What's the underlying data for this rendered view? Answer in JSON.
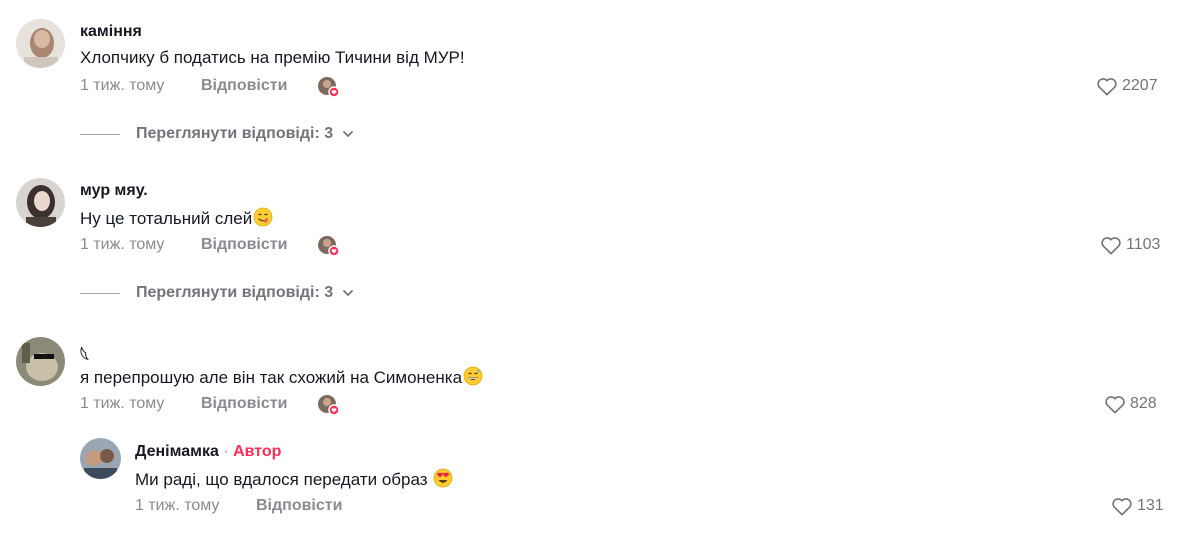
{
  "comments": [
    {
      "username": "каміння",
      "text": "Хлопчику б податись на премію Тичини від МУР!",
      "time": "1 тиж. тому",
      "reply_label": "Відповісти",
      "likes": "2207",
      "view_replies": "Переглянути відповіді: 3"
    },
    {
      "username": "мур мяу.",
      "text": "Ну це тотальний слей",
      "time": "1 тиж. тому",
      "reply_label": "Відповісти",
      "likes": "1103",
      "view_replies": "Переглянути відповіді: 3"
    },
    {
      "username": "𓆩",
      "text": "я перепрошую але він так схожий на Симоненка",
      "time": "1 тиж. тому",
      "reply_label": "Відповісти",
      "likes": "828"
    }
  ],
  "reply": {
    "username": "Денімамка",
    "separator": " · ",
    "author_label": "Автор",
    "text": "Ми раді, що вдалося передати образ",
    "time": "1 тиж. тому",
    "reply_label": "Відповісти",
    "likes": "131"
  },
  "colors": {
    "accent": "#fe2c55",
    "muted_text": "#8a8b91",
    "primary_text": "#161823"
  },
  "icons": {
    "like": "heart-outline-icon",
    "creator_liked": "creator-liked-avatar-heart",
    "chevron": "chevron-down-icon",
    "emoji_yum": "face-savoring-food-emoji",
    "emoji_sweat": "grinning-face-with-sweat-emoji",
    "emoji_heart_eyes": "heart-eyes-emoji"
  }
}
